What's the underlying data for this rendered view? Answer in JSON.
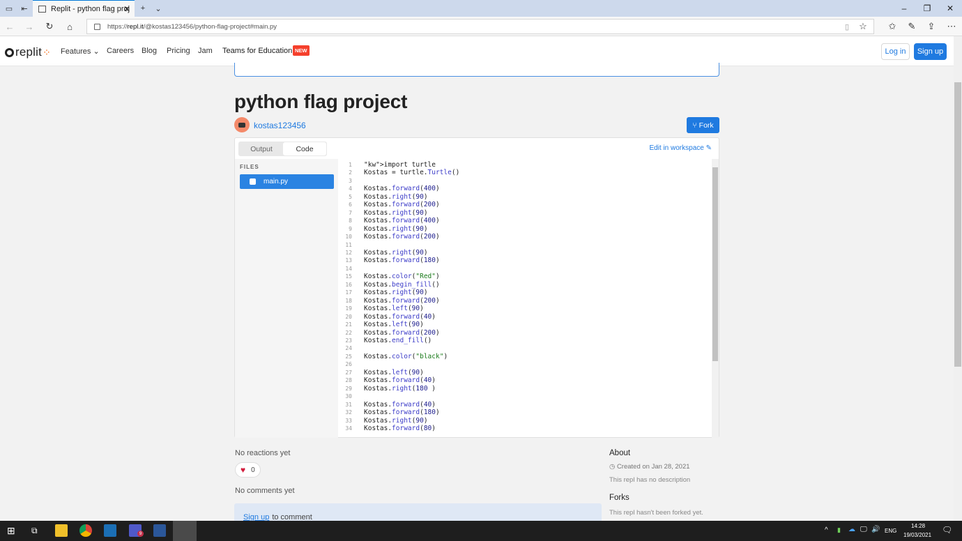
{
  "browser": {
    "tab_title": "Replit - python flag proj",
    "url_prefix": "https://",
    "url_host": "repl.it",
    "url_path": "/@kostas123456/python-flag-project#main.py"
  },
  "header": {
    "logo_text": "replit",
    "nav": [
      "Features",
      "Careers",
      "Blog",
      "Pricing",
      "Jam",
      "Teams for Education"
    ],
    "new_badge": "NEW",
    "login": "Log in",
    "signup": "Sign up"
  },
  "repl": {
    "title": "python flag project",
    "username": "kostas123456",
    "fork_label": "Fork",
    "tabs": [
      "Output",
      "Code"
    ],
    "active_tab": "Code",
    "edit_workspace": "Edit in workspace",
    "files_label": "FILES",
    "file": "main.py"
  },
  "code_lines": [
    "import turtle",
    "Kostas = turtle.Turtle()",
    "",
    "Kostas.forward(400)",
    "Kostas.right(90)",
    "Kostas.forward(200)",
    "Kostas.right(90)",
    "Kostas.forward(400)",
    "Kostas.right(90)",
    "Kostas.forward(200)",
    "",
    "Kostas.right(90)",
    "Kostas.forward(180)",
    "",
    "Kostas.color(\"Red\")",
    "Kostas.begin_fill()",
    "Kostas.right(90)",
    "Kostas.forward(200)",
    "Kostas.left(90)",
    "Kostas.forward(40)",
    "Kostas.left(90)",
    "Kostas.forward(200)",
    "Kostas.end_fill()",
    "",
    "Kostas.color(\"black\")",
    "",
    "Kostas.left(90)",
    "Kostas.forward(40)",
    "Kostas.right(180 )",
    "",
    "Kostas.forward(40)",
    "Kostas.forward(180)",
    "Kostas.right(90)",
    "Kostas.forward(80)"
  ],
  "reactions": {
    "none_text": "No reactions yet",
    "count": "0",
    "comments_text": "No comments yet",
    "signup_link": "Sign up",
    "to_comment": "to comment"
  },
  "about": {
    "heading": "About",
    "created": "Created on Jan 28, 2021",
    "description": "This repl has no description",
    "forks_heading": "Forks",
    "forks_text": "This repl hasn't been forked yet."
  },
  "taskbar": {
    "lang": "ENG",
    "time": "14:28",
    "date": "19/03/2021",
    "teams_badge": "9"
  },
  "colors": {
    "accent": "#1f7ae0",
    "new_badge": "#f5402c",
    "heart": "#d21a3a"
  }
}
